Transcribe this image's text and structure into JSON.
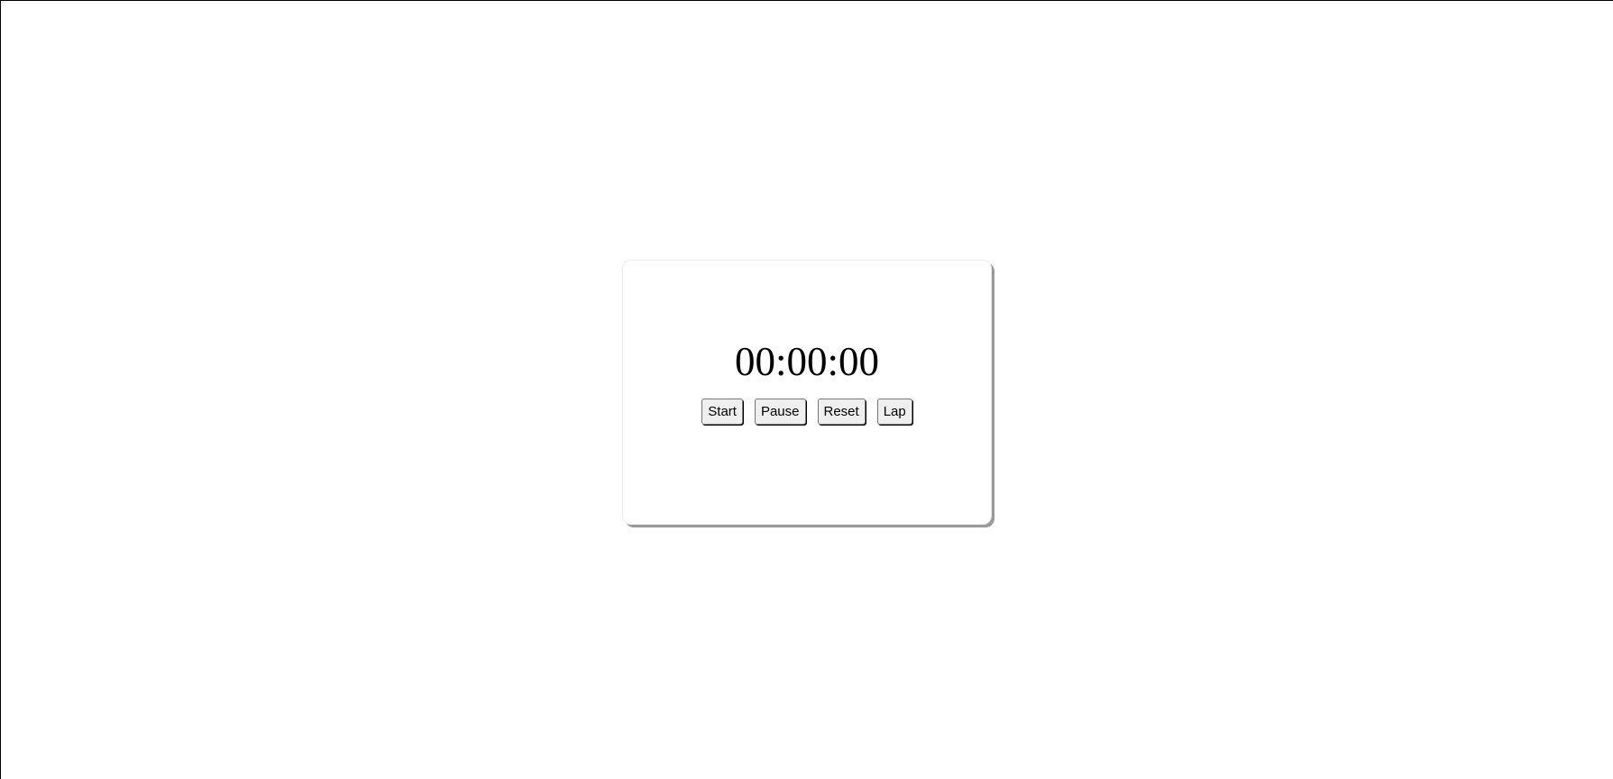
{
  "stopwatch": {
    "time": "00:00:00",
    "buttons": {
      "start": "Start",
      "pause": "Pause",
      "reset": "Reset",
      "lap": "Lap"
    }
  }
}
